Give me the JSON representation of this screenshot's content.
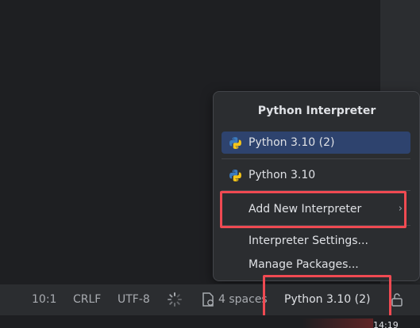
{
  "popup": {
    "title": "Python Interpreter",
    "items": [
      {
        "label": "Python 3.10 (2)",
        "icon": "python-icon",
        "selected": true
      },
      {
        "label": "Python 3.10",
        "icon": "python-icon",
        "selected": false
      },
      {
        "label": "Add New Interpreter",
        "submenu_indicator": "›"
      },
      {
        "label": "Interpreter Settings..."
      },
      {
        "label": "Manage Packages..."
      }
    ]
  },
  "statusbar": {
    "position": "10:1",
    "line_ending": "CRLF",
    "encoding": "UTF-8",
    "indent": "4 spaces",
    "interpreter": "Python 3.10 (2)"
  },
  "clock": "14:19",
  "colors": {
    "highlight": "#f04a52",
    "selected_bg": "#2e436e",
    "popup_bg": "#2b2d30"
  }
}
